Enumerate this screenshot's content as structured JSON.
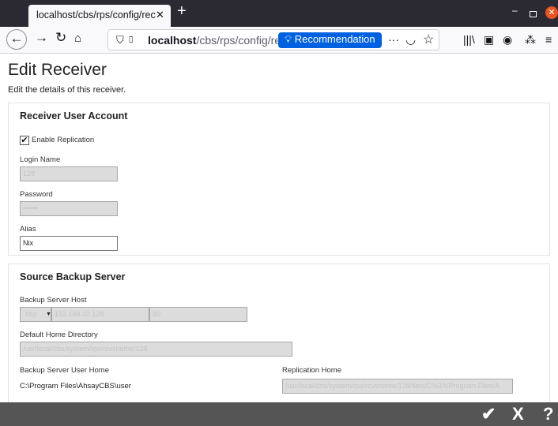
{
  "browser": {
    "tab_title": "localhost/cbs/rps/config/rec",
    "tab_close": "✕",
    "new_tab": "+",
    "url_host": "localhost",
    "url_path": "/cbs/rps/config/rece",
    "recommendation_label": "Recommendation",
    "more_label": "···"
  },
  "page": {
    "title": "Edit Receiver",
    "description": "Edit the details of this receiver."
  },
  "receiver_account": {
    "heading": "Receiver User Account",
    "enable_replication_label": "Enable Replication",
    "enable_replication_checked": true,
    "login_name_label": "Login Name",
    "login_name_value": "128",
    "password_label": "Password",
    "password_value": "••••••",
    "alias_label": "Alias",
    "alias_value": "Nix"
  },
  "source_server": {
    "heading": "Source Backup Server",
    "host_label": "Backup Server Host",
    "protocol_value": "http",
    "host_value": "192.168.32.128",
    "port_value": "80",
    "home_dir_label": "Default Home Directory",
    "home_dir_value": "/usr/local/cbs/system/rps/rcvshome/128",
    "user_home_label": "Backup Server User Home",
    "user_home_value": "C:\\Program Files\\AhsayCBS\\user",
    "replication_home_label": "Replication Home",
    "replication_home_value": "/usr/local/cbs/system/rps/rcvshome/128/files/C%3A/Program Files/A"
  },
  "actions": {
    "save": "✔",
    "cancel": "X",
    "help": "?"
  }
}
